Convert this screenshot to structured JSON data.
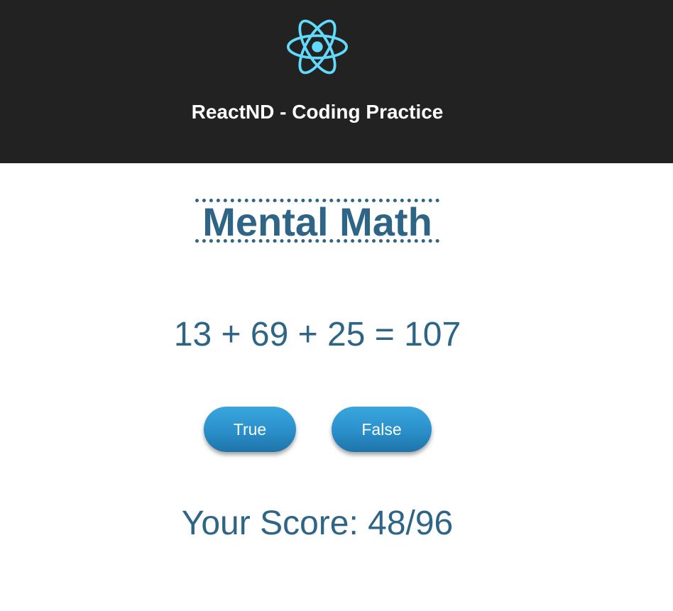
{
  "header": {
    "title": "ReactND - Coding Practice",
    "logo_icon": "react-atom-icon",
    "background": "#222222",
    "logo_color": "#61dafb"
  },
  "game": {
    "title": "Mental Math",
    "equation": "13 + 69 + 25 = 107",
    "true_label": "True",
    "false_label": "False",
    "score": "Your Score: 48/96",
    "accent_color": "#2e6586",
    "button_color": "#2a8fca"
  }
}
